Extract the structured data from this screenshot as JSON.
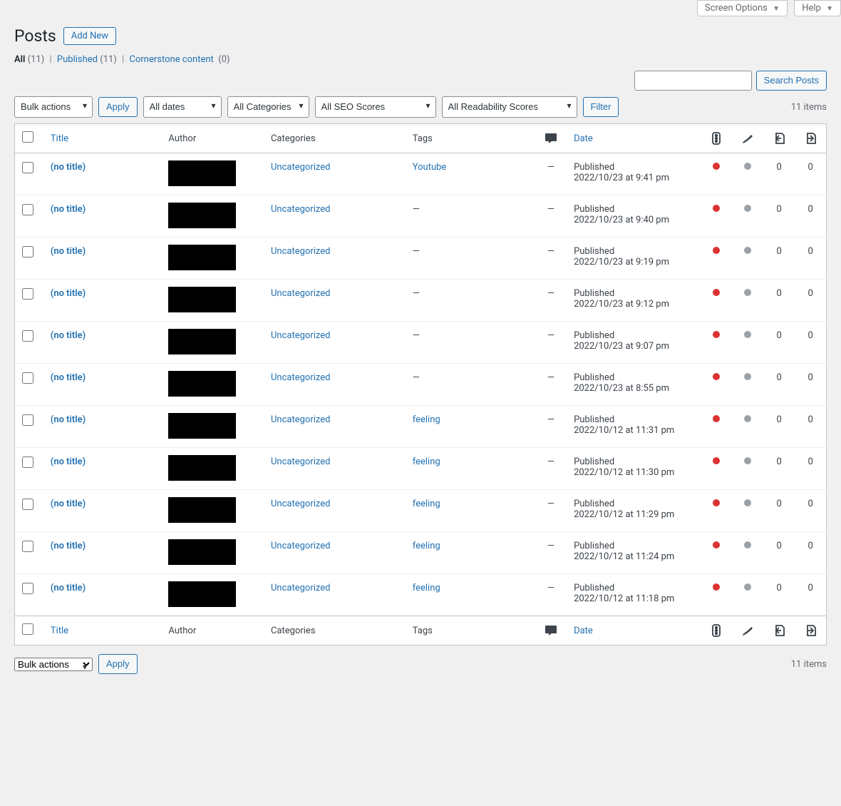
{
  "screen_controls": {
    "screen_options": "Screen Options",
    "help": "Help"
  },
  "page": {
    "title": "Posts",
    "add_new": "Add New"
  },
  "filters_tabs": {
    "all_label": "All",
    "all_count": "(11)",
    "published_label": "Published",
    "published_count": "(11)",
    "cornerstone_label": "Cornerstone content",
    "cornerstone_count": "(0)"
  },
  "search": {
    "button": "Search Posts",
    "value": ""
  },
  "bulk": {
    "label": "Bulk actions",
    "apply": "Apply"
  },
  "filter_selects": {
    "dates": "All dates",
    "categories": "All Categories",
    "seo": "All SEO Scores",
    "readability": "All Readability Scores",
    "filter_btn": "Filter"
  },
  "count_text": "11 items",
  "columns": {
    "title": "Title",
    "author": "Author",
    "categories": "Categories",
    "tags": "Tags",
    "date": "Date"
  },
  "rows": [
    {
      "title": "(no title)",
      "category": "Uncategorized",
      "tags": "Youtube",
      "pub": "Published",
      "date": "2022/10/23 at 9:41 pm",
      "n1": "0",
      "n2": "0"
    },
    {
      "title": "(no title)",
      "category": "Uncategorized",
      "tags": "",
      "pub": "Published",
      "date": "2022/10/23 at 9:40 pm",
      "n1": "0",
      "n2": "0"
    },
    {
      "title": "(no title)",
      "category": "Uncategorized",
      "tags": "",
      "pub": "Published",
      "date": "2022/10/23 at 9:19 pm",
      "n1": "0",
      "n2": "0"
    },
    {
      "title": "(no title)",
      "category": "Uncategorized",
      "tags": "",
      "pub": "Published",
      "date": "2022/10/23 at 9:12 pm",
      "n1": "0",
      "n2": "0"
    },
    {
      "title": "(no title)",
      "category": "Uncategorized",
      "tags": "",
      "pub": "Published",
      "date": "2022/10/23 at 9:07 pm",
      "n1": "0",
      "n2": "0"
    },
    {
      "title": "(no title)",
      "category": "Uncategorized",
      "tags": "",
      "pub": "Published",
      "date": "2022/10/23 at 8:55 pm",
      "n1": "0",
      "n2": "0"
    },
    {
      "title": "(no title)",
      "category": "Uncategorized",
      "tags": "feeling",
      "pub": "Published",
      "date": "2022/10/12 at 11:31 pm",
      "n1": "0",
      "n2": "0"
    },
    {
      "title": "(no title)",
      "category": "Uncategorized",
      "tags": "feeling",
      "pub": "Published",
      "date": "2022/10/12 at 11:30 pm",
      "n1": "0",
      "n2": "0"
    },
    {
      "title": "(no title)",
      "category": "Uncategorized",
      "tags": "feeling",
      "pub": "Published",
      "date": "2022/10/12 at 11:29 pm",
      "n1": "0",
      "n2": "0"
    },
    {
      "title": "(no title)",
      "category": "Uncategorized",
      "tags": "feeling",
      "pub": "Published",
      "date": "2022/10/12 at 11:24 pm",
      "n1": "0",
      "n2": "0"
    },
    {
      "title": "(no title)",
      "category": "Uncategorized",
      "tags": "feeling",
      "pub": "Published",
      "date": "2022/10/12 at 11:18 pm",
      "n1": "0",
      "n2": "0"
    }
  ]
}
